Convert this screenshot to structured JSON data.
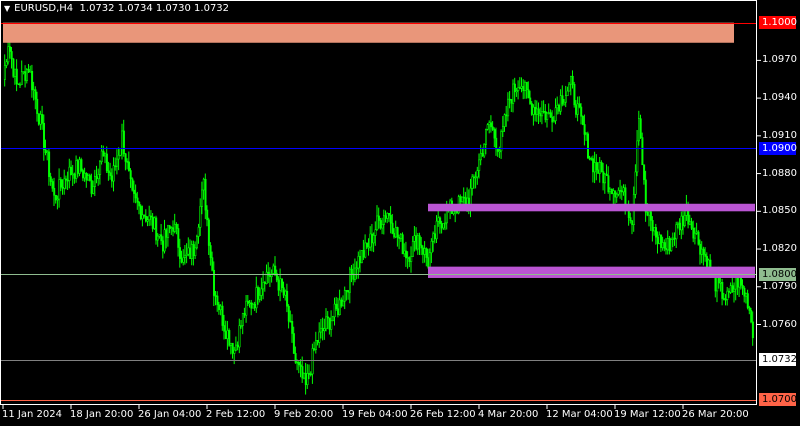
{
  "header": {
    "symbol_timeframe": "EURUSD,H4",
    "ohlc": "1.0732 1.0734 1.0730 1.0732"
  },
  "colors": {
    "background": "#000000",
    "candle": "#00ff00",
    "text": "#ffffff",
    "level_red": "#ff0000",
    "level_blue": "#0000ff",
    "level_green": "#8fbc8f",
    "level_orange": "#ff6347",
    "current_price_line": "#808080",
    "zone_salmon": "#e9967a",
    "zone_orchid": "#ba55d3"
  },
  "chart_data": {
    "type": "candlestick",
    "symbol": "EURUSD",
    "timeframe": "H4",
    "ylim": [
      1.0696,
      1.1018
    ],
    "y_ticks": [
      "1.0970",
      "1.0940",
      "1.0910",
      "1.0880",
      "1.0850",
      "1.0820",
      "1.0790",
      "1.0760"
    ],
    "x_ticks": [
      "11 Jan 2024",
      "18 Jan 20:00",
      "26 Jan 04:00",
      "2 Feb 12:00",
      "9 Feb 20:00",
      "19 Feb 04:00",
      "26 Feb 12:00",
      "4 Mar 20:00",
      "12 Mar 04:00",
      "19 Mar 12:00",
      "26 Mar 20:00"
    ],
    "x_tick_index": [
      0,
      40,
      80,
      120,
      160,
      200,
      240,
      280,
      320,
      360,
      400
    ],
    "bar_count": 430,
    "price_path": [
      [
        0,
        1.0955
      ],
      [
        3,
        1.0985
      ],
      [
        8,
        1.095
      ],
      [
        15,
        1.0965
      ],
      [
        22,
        1.092
      ],
      [
        30,
        1.086
      ],
      [
        38,
        1.088
      ],
      [
        45,
        1.0885
      ],
      [
        52,
        1.087
      ],
      [
        58,
        1.0895
      ],
      [
        64,
        1.0875
      ],
      [
        70,
        1.091
      ],
      [
        76,
        1.086
      ],
      [
        82,
        1.085
      ],
      [
        88,
        1.084
      ],
      [
        94,
        1.0825
      ],
      [
        100,
        1.084
      ],
      [
        106,
        1.081
      ],
      [
        112,
        1.082
      ],
      [
        118,
        1.087
      ],
      [
        124,
        1.079
      ],
      [
        130,
        1.076
      ],
      [
        136,
        1.074
      ],
      [
        142,
        1.077
      ],
      [
        148,
        1.078
      ],
      [
        154,
        1.08
      ],
      [
        160,
        1.08
      ],
      [
        166,
        1.078
      ],
      [
        172,
        1.073
      ],
      [
        178,
        1.071
      ],
      [
        184,
        1.0745
      ],
      [
        190,
        1.076
      ],
      [
        196,
        1.077
      ],
      [
        202,
        1.079
      ],
      [
        208,
        1.081
      ],
      [
        214,
        1.082
      ],
      [
        220,
        1.084
      ],
      [
        226,
        1.085
      ],
      [
        232,
        1.083
      ],
      [
        238,
        1.0815
      ],
      [
        244,
        1.083
      ],
      [
        250,
        1.081
      ],
      [
        256,
        1.084
      ],
      [
        262,
        1.085
      ],
      [
        268,
        1.0855
      ],
      [
        274,
        1.086
      ],
      [
        280,
        1.089
      ],
      [
        286,
        1.092
      ],
      [
        292,
        1.09
      ],
      [
        298,
        1.094
      ],
      [
        304,
        1.0955
      ],
      [
        310,
        1.0935
      ],
      [
        316,
        1.093
      ],
      [
        322,
        1.0925
      ],
      [
        328,
        1.094
      ],
      [
        334,
        1.095
      ],
      [
        340,
        1.092
      ],
      [
        346,
        1.089
      ],
      [
        352,
        1.088
      ],
      [
        358,
        1.087
      ],
      [
        364,
        1.0865
      ],
      [
        370,
        1.0845
      ],
      [
        374,
        1.093
      ],
      [
        378,
        1.085
      ],
      [
        384,
        1.083
      ],
      [
        390,
        1.082
      ],
      [
        396,
        1.0835
      ],
      [
        402,
        1.085
      ],
      [
        408,
        1.083
      ],
      [
        414,
        1.081
      ],
      [
        420,
        1.079
      ],
      [
        426,
        1.078
      ],
      [
        432,
        1.0795
      ],
      [
        438,
        1.078
      ],
      [
        444,
        1.0732
      ]
    ],
    "levels": [
      {
        "price": 1.1,
        "label": "1.1000",
        "color": "#ff0000",
        "tag_bg": "#ff0000",
        "tag_fg": "#ffffff"
      },
      {
        "price": 1.09,
        "label": "1.0900",
        "color": "#0000ff",
        "tag_bg": "#0000ff",
        "tag_fg": "#ffffff"
      },
      {
        "price": 1.08,
        "label": "1.0800",
        "color": "#8fbc8f",
        "tag_bg": "#8fbc8f",
        "tag_fg": "#000000"
      },
      {
        "price": 1.0732,
        "label": "1.0732",
        "color": "#808080",
        "tag_bg": "#ffffff",
        "tag_fg": "#000000"
      },
      {
        "price": 1.07,
        "label": "1.0700",
        "color": "#ff6347",
        "tag_bg": "#ff6347",
        "tag_fg": "#000000"
      }
    ],
    "zones": [
      {
        "name": "resistance-zone-1.1000",
        "from_bar": 0,
        "to_bar": 430,
        "price_top": 1.1,
        "price_bottom": 1.0984,
        "color": "#e9967a"
      },
      {
        "name": "zone-1.0853",
        "from_bar": 250,
        "to_bar": 474,
        "price_top": 1.0856,
        "price_bottom": 1.085,
        "color": "#ba55d3"
      },
      {
        "name": "zone-1.0803",
        "from_bar": 250,
        "to_bar": 474,
        "price_top": 1.0806,
        "price_bottom": 1.0797,
        "color": "#ba55d3"
      }
    ]
  }
}
